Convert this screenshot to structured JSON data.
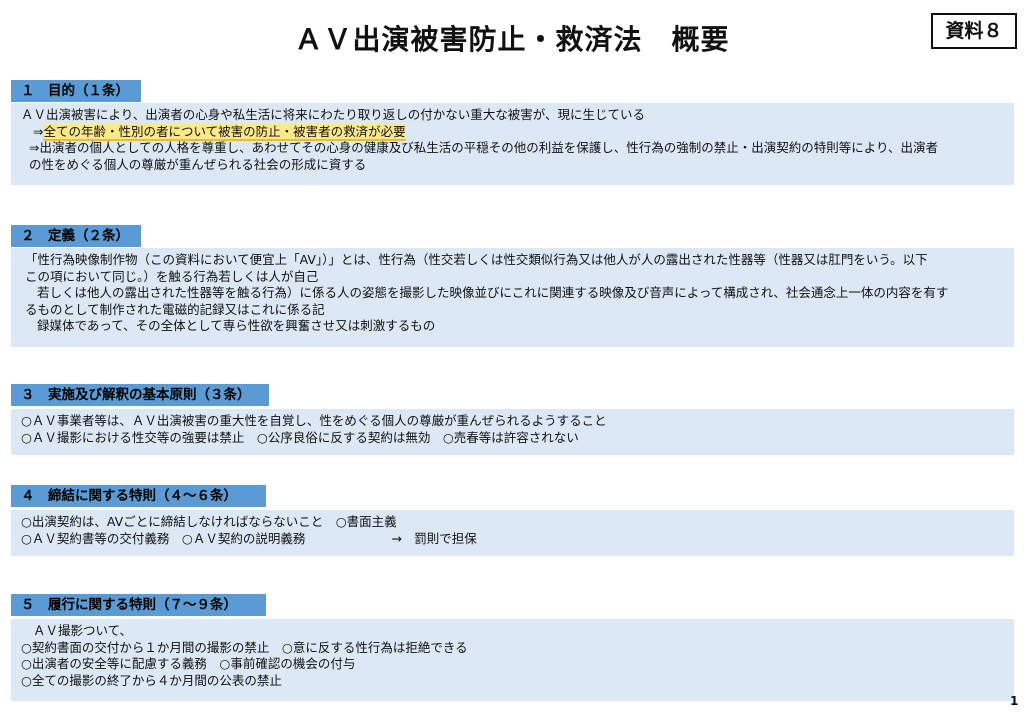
{
  "title": "ＡＶ出演被害防止・救済法　概要",
  "doc_badge": "資料８",
  "page_number": "1",
  "highlight_color": "#fde98a",
  "sections": [
    {
      "header": "１　目的（１条）",
      "lines": [
        "ＡＶ出演被害により、出演者の心身や私生活に将来にわたり取り返しの付かない重大な被害が、現に生じている",
        "全ての年齢・性別の者について被害の防止・被害者の救済が必要",
        "⇒出演者の個人としての人格を尊重し、あわせてその心身の健康及び私生活の平穏その他の利益を保護し、性行為の強制の禁止・出演契約の特則等により、出演者",
        "の性をめぐる個人の尊厳が重んぜられる社会の形成に資する"
      ],
      "arrow_prefix": "⇒"
    },
    {
      "header": "２　定義（２条）",
      "lines": [
        "「性行為映像制作物（この資料において便宜上「AV」）」とは、性行為（性交若しくは性交類似行為又は他人が人の露出された性器等（性器又は肛門をいう。以下",
        "この項において同じ。）を触る行為若しくは人が自己",
        "若しくは他人の露出された性器等を触る行為）に係る人の姿態を撮影した映像並びにこれに関連する映像及び音声によって構成され、社会通念上一体の内容を有す",
        "るものとして制作された電磁的記録又はこれに係る記",
        "録媒体であって、その全体として専ら性欲を興奮させ又は刺激するもの"
      ]
    },
    {
      "header": "３　実施及び解釈の基本原則（３条）",
      "lines": [
        "○ＡＶ事業者等は、ＡＶ出演被害の重大性を自覚し、性をめぐる個人の尊厳が重んぜられるようすること",
        "○ＡＶ撮影における性交等の強要は禁止　○公序良俗に反する契約は無効　○売春等は許容されない"
      ]
    },
    {
      "header": "４　締結に関する特則（４～６条）",
      "lines": [
        "○出演契約は、AVごとに締結しなければならないこと　○書面主義",
        "○ＡＶ契約書等の交付義務　○ＡＶ契約の説明義務",
        "→　罰則で担保"
      ]
    },
    {
      "header": "５　履行に関する特則（７～９条）",
      "lines": [
        "ＡＶ撮影ついて、",
        "○契約書面の交付から１か月間の撮影の禁止　○意に反する性行為は拒絶できる",
        "○出演者の安全等に配慮する義務　○事前確認の機会の付与",
        "○全ての撮影の終了から４か月間の公表の禁止"
      ]
    }
  ]
}
